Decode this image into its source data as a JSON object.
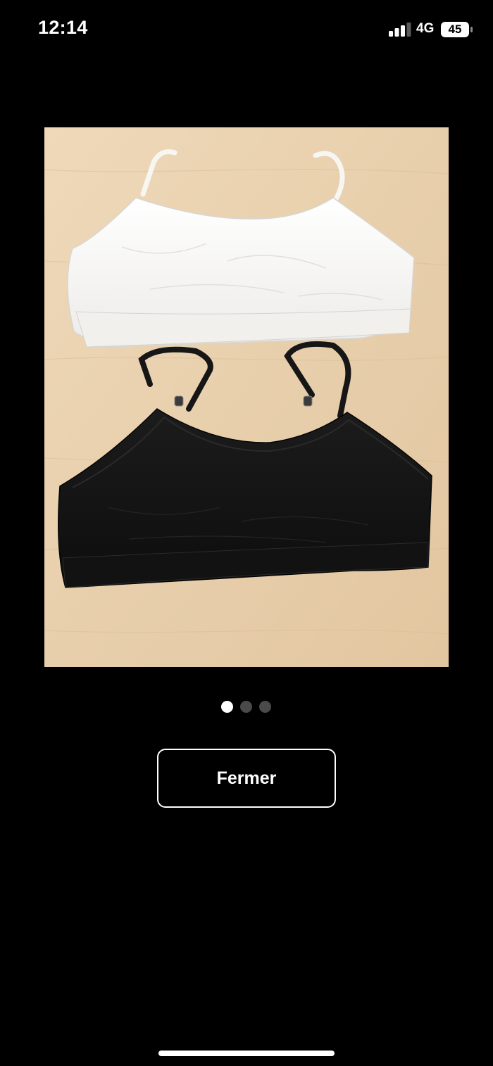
{
  "status_bar": {
    "time": "12:14",
    "network": "4G",
    "battery": "45"
  },
  "gallery": {
    "photo_count": 3,
    "active_index": 0
  },
  "actions": {
    "close_label": "Fermer"
  },
  "colors": {
    "background": "#000000",
    "text": "#ffffff",
    "dot_active": "#ffffff",
    "dot_inactive": "#4a4a4a"
  }
}
